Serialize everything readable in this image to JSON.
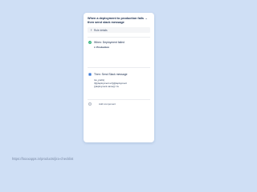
{
  "card": {
    "title": "When a deployment to production fails → then send slack message",
    "rule_details_label": "Rule details"
  },
  "trigger": {
    "label": "When: Deployment failed",
    "environment_prefix": "in",
    "environment_value": "Production",
    "icon": "check-circle-icon",
    "color": "#36b37e"
  },
  "action": {
    "label": "Then: Send Slack message",
    "lines": [
      "rss_prefix}",
      "rl}{{deployment.url}}{{deployment",
      "{{deployment.name}}> fa"
    ],
    "icon": "radio-selected-icon",
    "color": "#0052cc"
  },
  "add_component": {
    "label": "Add component",
    "icon": "plus-circle-icon"
  },
  "footer": {
    "url": "https://boxxapps.in/products/jira-checklist"
  }
}
